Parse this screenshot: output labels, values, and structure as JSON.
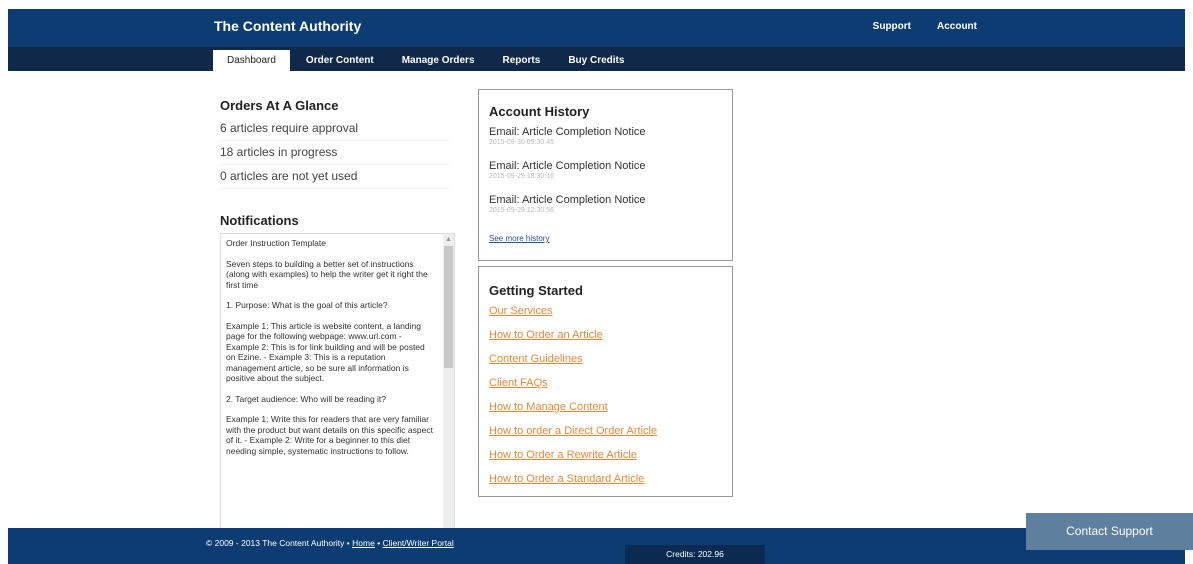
{
  "header": {
    "brand": "The Content Authority",
    "links": [
      "Support",
      "Account"
    ]
  },
  "nav": {
    "tabs": [
      "Dashboard",
      "Order Content",
      "Manage Orders",
      "Reports",
      "Buy Credits"
    ],
    "active": "Dashboard"
  },
  "glance": {
    "title": "Orders At A Glance",
    "lines": [
      "6 articles require approval",
      "18 articles in progress",
      "0 articles are not yet used"
    ]
  },
  "notifications": {
    "title": "Notifications",
    "paragraphs": [
      "Order Instruction Template",
      "Seven steps to building a better set of instructions (along with examples) to help the writer get it right the first time",
      "1. Purpose: What is the goal of this article?",
      "Example 1: This article is website content, a landing page for the following webpage: www.url.com - Example 2: This is for link building and will be posted on Ezine. - Example 3: This is a reputation management article, so be sure all information is positive about the subject.",
      "2. Target audience: Who will be reading it?",
      "Example 1: Write this for readers that are very familiar with the product but want details on this specific aspect of it. - Example 2: Write for a beginner to this diet needing simple, systematic instructions to follow."
    ]
  },
  "history": {
    "title": "Account History",
    "items": [
      {
        "text": "Email: Article Completion Notice",
        "date": "2015-09-30 09:30:45"
      },
      {
        "text": "Email: Article Completion Notice",
        "date": "2015-09-29 18:30:16"
      },
      {
        "text": "Email: Article Completion Notice",
        "date": "2015-09-29 12:30:56"
      }
    ],
    "more": "See more history"
  },
  "getting_started": {
    "title": "Getting Started",
    "links": [
      "Our Services",
      "How to Order an Article",
      "Content Guidelines",
      "Client FAQs",
      "How to Manage Content",
      "How to order a Direct Order Article",
      "How to Order a Rewrite Article",
      "How to Order a Standard Article"
    ]
  },
  "footer": {
    "copyright": "© 2009 - 2013 The Content Authority •",
    "home": "Home",
    "sep": "•",
    "portal": "Client/Writer Portal",
    "credits": "Credits: 202.96"
  },
  "contact": "Contact Support",
  "colors": {
    "header": "#0d3c73",
    "nav": "#10294a",
    "link_orange": "#e38a39",
    "contact_bg": "#5e7f9e"
  }
}
